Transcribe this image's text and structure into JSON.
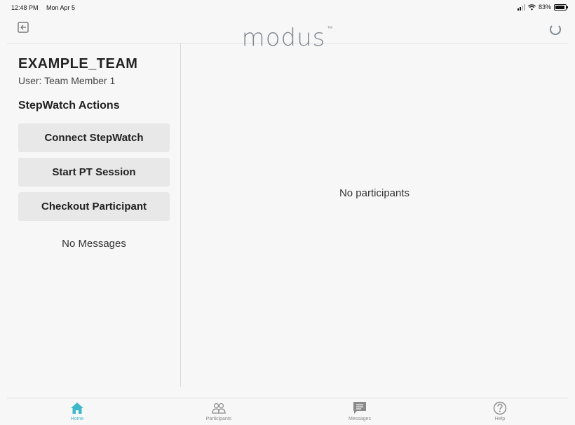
{
  "status_bar": {
    "time": "12:48 PM",
    "date": "Mon Apr 5",
    "battery": "83%",
    "battery_level": 0.83,
    "icons": [
      "signal-icon",
      "wifi-icon",
      "battery-icon"
    ]
  },
  "nav": {
    "logo": "modus",
    "logo_tm": "™",
    "left_icon": "logout-icon",
    "right_icon": "loading-spinner-icon"
  },
  "sidebar": {
    "team_name": "EXAMPLE_TEAM",
    "user_label": "User: Team Member 1",
    "actions_heading": "StepWatch Actions",
    "buttons": [
      {
        "label": "Connect StepWatch"
      },
      {
        "label": "Start PT Session"
      },
      {
        "label": "Checkout Participant"
      }
    ],
    "messages_status": "No Messages"
  },
  "main": {
    "empty_text": "No participants"
  },
  "tabs": [
    {
      "label": "Home",
      "icon": "home-icon",
      "active": true
    },
    {
      "label": "Participants",
      "icon": "participants-icon",
      "active": false
    },
    {
      "label": "Messages",
      "icon": "messages-icon",
      "active": false
    },
    {
      "label": "Help",
      "icon": "help-icon",
      "active": false
    }
  ],
  "colors": {
    "accent": "#3db8c9",
    "inactive_icon": "#8a8a8a",
    "logo": "#7f8890",
    "background": "#f7f7f7",
    "button_bg": "#e8e8e8"
  }
}
